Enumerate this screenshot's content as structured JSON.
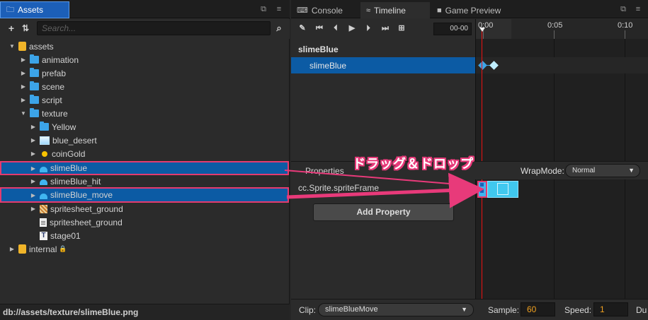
{
  "assets": {
    "tab_label": "Assets",
    "search_placeholder": "Search...",
    "tree": [
      {
        "label": "assets",
        "icon": "db-icon"
      },
      {
        "label": "animation",
        "icon": "folder-icon"
      },
      {
        "label": "prefab",
        "icon": "folder-icon"
      },
      {
        "label": "scene",
        "icon": "folder-icon"
      },
      {
        "label": "script",
        "icon": "folder-icon"
      },
      {
        "label": "texture",
        "icon": "folder-icon"
      },
      {
        "label": "Yellow",
        "icon": "folder-icon"
      },
      {
        "label": "blue_desert",
        "icon": "image-icon"
      },
      {
        "label": "coinGold",
        "icon": "coin-icon"
      },
      {
        "label": "slimeBlue",
        "icon": "slime-icon"
      },
      {
        "label": "slimeBlue_hit",
        "icon": "slime-icon"
      },
      {
        "label": "slimeBlue_move",
        "icon": "slime-icon"
      },
      {
        "label": "spritesheet_ground",
        "icon": "spritesheet-icon"
      },
      {
        "label": "spritesheet_ground",
        "icon": "document-icon"
      },
      {
        "label": "stage01",
        "icon": "text-asset-icon"
      },
      {
        "label": "internal",
        "icon": "db-icon"
      }
    ],
    "status_path": "db://assets/texture/slimeBlue.png"
  },
  "right_tabs": {
    "console": "Console",
    "timeline": "Timeline",
    "game_preview": "Game Preview"
  },
  "timeline": {
    "time_value": "00-00",
    "ruler_labels": [
      "0:00",
      "0:05",
      "0:10"
    ],
    "node_title": "slimeBlue",
    "node_row": "slimeBlue",
    "properties_label": "Properties",
    "wrap_mode_label": "WrapMode:",
    "wrap_mode_value": "Normal",
    "property_name": "cc.Sprite.spriteFrame",
    "add_property": "Add Property",
    "clip_label": "Clip:",
    "clip_value": "slimeBlueMove",
    "sample_label": "Sample:",
    "sample_value": "60",
    "speed_label": "Speed:",
    "speed_value": "1",
    "duration_label_partial": "Du"
  },
  "annotation": {
    "text": "ドラッグ＆ドロップ",
    "color": "#e83a7a"
  },
  "colors": {
    "selection": "#0c5ba4",
    "accent_tab": "#1c5fb8",
    "playhead": "#e11111",
    "keyframe": "#40b5f0"
  }
}
